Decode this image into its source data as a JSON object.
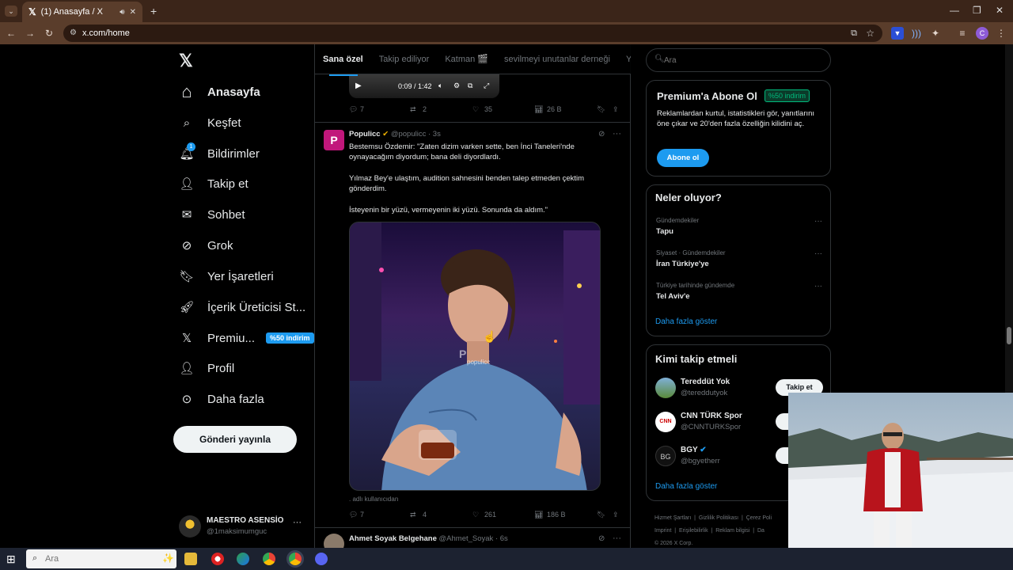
{
  "browser": {
    "tab_title": "(1) Anasayfa / X",
    "url": "x.com/home"
  },
  "nav": {
    "items": [
      {
        "label": "Anasayfa",
        "icon": "home-icon"
      },
      {
        "label": "Keşfet",
        "icon": "search-icon"
      },
      {
        "label": "Bildirimler",
        "icon": "bell-icon",
        "badge": "1"
      },
      {
        "label": "Takip et",
        "icon": "follow-icon"
      },
      {
        "label": "Sohbet",
        "icon": "mail-icon"
      },
      {
        "label": "Grok",
        "icon": "grok-icon"
      },
      {
        "label": "Yer İşaretleri",
        "icon": "bookmark-icon"
      },
      {
        "label": "İçerik Üreticisi St...",
        "icon": "rocket-icon"
      },
      {
        "label": "Premiu...",
        "icon": "x-premium-icon",
        "tag": "%50 indirim"
      },
      {
        "label": "Profil",
        "icon": "profile-icon"
      },
      {
        "label": "Daha fazla",
        "icon": "more-circle-icon"
      }
    ],
    "post_button": "Gönderi yayınla",
    "account": {
      "name": "MAESTRO ASENSİO",
      "handle": "@1maksimumguc"
    }
  },
  "feed": {
    "tabs": [
      "Sana özel",
      "Takip ediliyor",
      "Katman 🎬",
      "sevilmeyi unutanlar derneği",
      "Ya"
    ],
    "video_controls": {
      "time": "0:09 / 1:42"
    },
    "prev_tweet_actions": {
      "replies": "7",
      "retweets": "2",
      "likes": "35",
      "views": "26 B"
    },
    "tweet": {
      "name": "Populicc",
      "handle": "@populicc",
      "time": "· 3s",
      "paragraphs": [
        "Bestemsu Özdemir: \"Zaten dizim varken sette, ben İnci Taneleri'nde oynayacağım diyordum; bana deli diyordlardı.",
        "Yılmaz Bey'e ulaştım, audition sahnesini benden talep etmeden çektim gönderdim.",
        "İsteyenin bir yüzü, vermeyenin iki yüzü. Sonunda da aldım.\""
      ],
      "watermark": "populicc",
      "caption": ". adlı kullanıcıdan",
      "actions": {
        "replies": "7",
        "retweets": "4",
        "likes": "261",
        "views": "186 B"
      }
    },
    "next_tweet": {
      "name": "Ahmet Soyak Belgehane",
      "handle": "@Ahmet_Soyak",
      "time": "· 6s"
    }
  },
  "sidebar": {
    "search_placeholder": "Ara",
    "premium": {
      "title": "Premium'a Abone Ol",
      "tag": "%50 indirim",
      "body": "Reklamlardan kurtul, istatistikleri gör, yanıtlarını öne çıkar ve 20'den fazla özelliğin kilidini aç.",
      "button": "Abone ol"
    },
    "trends": {
      "title": "Neler oluyor?",
      "items": [
        {
          "category": "Gündemdekiler",
          "name": "Tapu"
        },
        {
          "category": "Siyaset · Gündemdekiler",
          "name": "İran Türkiye'ye"
        },
        {
          "category": "Türkiye tarihinde gündemde",
          "name": "Tel Aviv'e"
        }
      ],
      "more": "Daha fazla göster"
    },
    "who_to_follow": {
      "title": "Kimi takip etmeli",
      "users": [
        {
          "name": "Tereddüt Yok",
          "handle": "@tereddutyok",
          "button": "Takip et"
        },
        {
          "name": "CNN TÜRK Spor",
          "handle": "@CNNTURKSpor"
        },
        {
          "name": "BGY",
          "handle": "@bgyetherr"
        }
      ],
      "more": "Daha fazla göster"
    },
    "footer": {
      "links": [
        "Hizmet Şartları",
        "Gizlilik Politikası",
        "Çerez Poli",
        "Imprint",
        "Erişilebilirlik",
        "Reklam bilgisi",
        "Da"
      ],
      "copyright": "© 2026 X Corp."
    }
  },
  "taskbar": {
    "search_placeholder": "Ara"
  }
}
